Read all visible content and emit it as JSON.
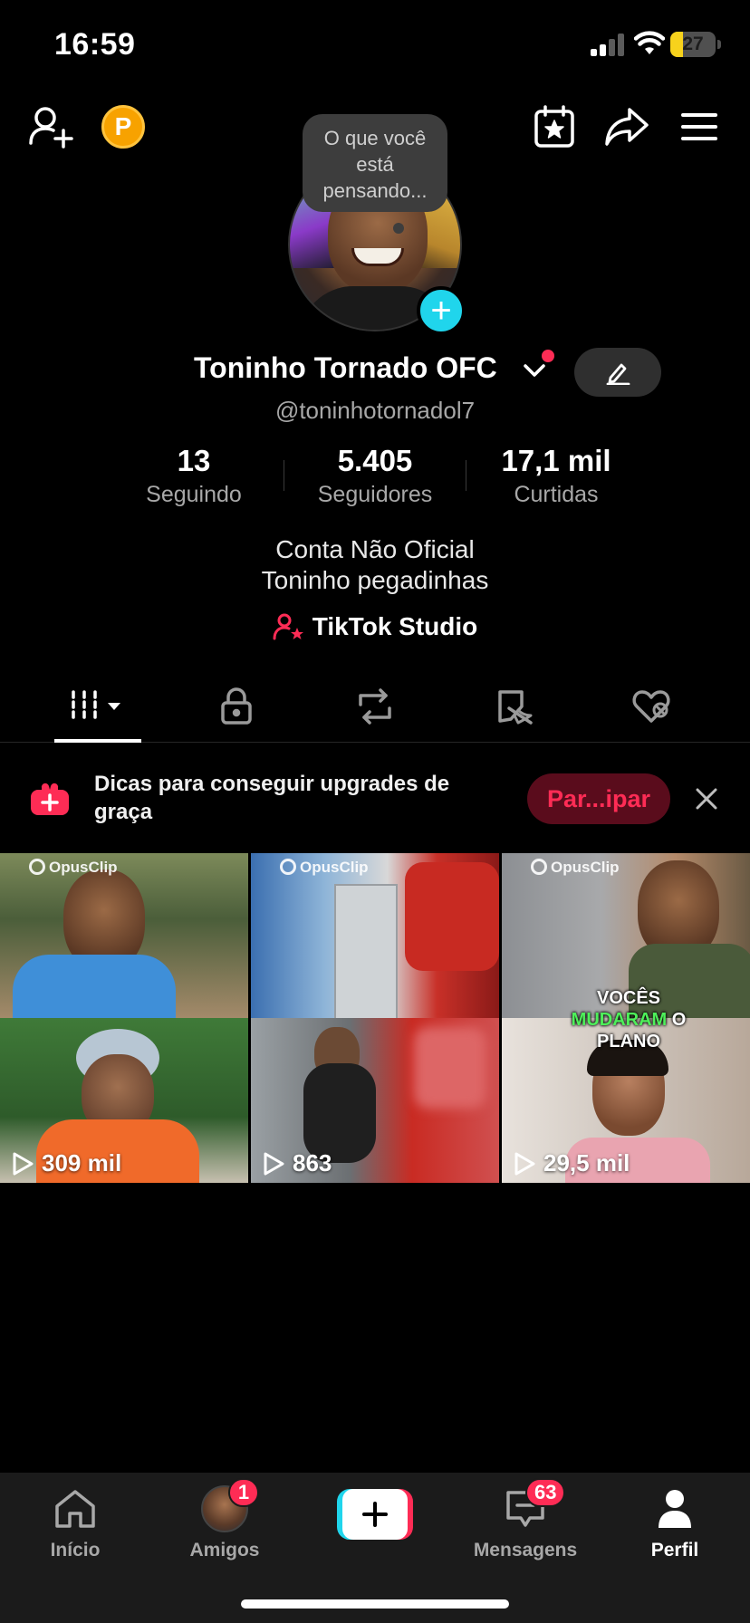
{
  "status_bar": {
    "time": "16:59",
    "battery_level": "27",
    "battery_fraction": 0.27
  },
  "header": {
    "coin_letter": "P",
    "thought_bubble": "O que você está pensando..."
  },
  "profile": {
    "display_name": "Toninho Tornado OFC",
    "handle": "@toninhotornadol7",
    "stats": [
      {
        "value": "13",
        "label": "Seguindo"
      },
      {
        "value": "5.405",
        "label": "Seguidores"
      },
      {
        "value": "17,1 mil",
        "label": "Curtidas"
      }
    ],
    "bio_line1": "Conta Não Oficial",
    "bio_line2": "Toninho pegadinhas",
    "studio_label": "TikTok Studio"
  },
  "tabs": [
    {
      "icon": "videos-grid-icon",
      "active": true
    },
    {
      "icon": "lock-icon",
      "active": false
    },
    {
      "icon": "repost-icon",
      "active": false
    },
    {
      "icon": "favorites-icon",
      "active": false
    },
    {
      "icon": "liked-icon",
      "active": false
    }
  ],
  "promo": {
    "text": "Dicas para conseguir upgrades de graça",
    "button_label": "Par...ipar"
  },
  "videos": [
    {
      "brand": "OpusClip",
      "views": "309 mil"
    },
    {
      "brand": "OpusClip",
      "views": "863"
    },
    {
      "brand": "OpusClip",
      "views": "29,5 mil",
      "caption_top": "VOCÊS",
      "caption_highlight": "MUDARAM",
      "caption_tail": "O",
      "caption_bottom": "PLANO"
    }
  ],
  "bottom_nav": {
    "home": "Início",
    "friends": "Amigos",
    "friends_badge": "1",
    "messages": "Mensagens",
    "messages_badge": "63",
    "profile": "Perfil"
  },
  "colors": {
    "accent": "#fe2c55",
    "cyan": "#20d5ec",
    "background": "#000000"
  }
}
